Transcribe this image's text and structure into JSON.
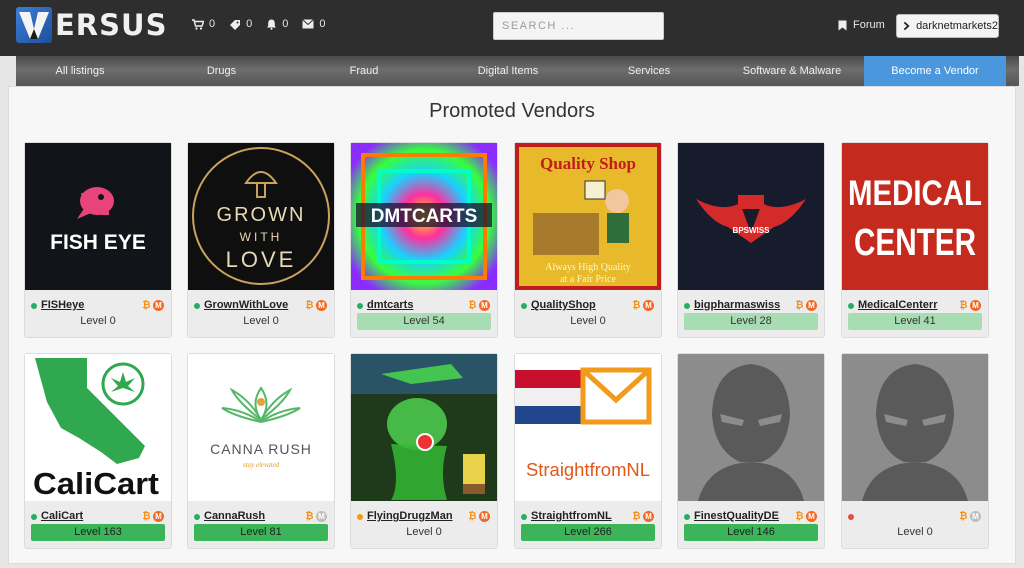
{
  "header": {
    "brand": "ERSUS",
    "logo_letter": "V",
    "counters": [
      {
        "icon": "cart-icon",
        "value": "0"
      },
      {
        "icon": "tag-icon",
        "value": "0"
      },
      {
        "icon": "bell-icon",
        "value": "0"
      },
      {
        "icon": "envelope-icon",
        "value": "0"
      }
    ],
    "search_placeholder": "SEARCH ...",
    "forum_label": "Forum",
    "username": "darknetmarkets2"
  },
  "nav": {
    "items": [
      "All listings",
      "Drugs",
      "Fraud",
      "Digital Items",
      "Services",
      "Software & Malware"
    ],
    "vendor_button": "Become a Vendor"
  },
  "section_title": "Promoted Vendors",
  "colors": {
    "online": "#27ae60",
    "away": "#f39c12",
    "offline": "#e74c3c",
    "level_green_dark": "#3cb55a",
    "level_green_light": "#a8dcb2",
    "accent_blue": "#4a97dd",
    "monero": "#f26822"
  },
  "vendors": [
    {
      "name": "FISHeye",
      "level": "Level 0",
      "status": "online",
      "xmr": true,
      "level_style": "plain",
      "image_text": [
        "FISH EYE"
      ]
    },
    {
      "name": "GrownWithLove",
      "level": "Level 0",
      "status": "online",
      "xmr": true,
      "level_style": "plain",
      "image_text": [
        "GROWN",
        "WITH",
        "LOVE"
      ]
    },
    {
      "name": "dmtcarts",
      "level": "Level 54",
      "status": "online",
      "xmr": true,
      "level_style": "light",
      "image_text": [
        "DMTCARTS"
      ]
    },
    {
      "name": "QualityShop",
      "level": "Level 0",
      "status": "online",
      "xmr": true,
      "level_style": "plain",
      "image_text": [
        "Quality Shop",
        "Always High Quality",
        "at a Fair Price"
      ]
    },
    {
      "name": "bigpharmaswiss",
      "level": "Level 28",
      "status": "online",
      "xmr": true,
      "level_style": "light",
      "image_text": [
        "BPSWISS"
      ]
    },
    {
      "name": "MedicalCenterr",
      "level": "Level 41",
      "status": "online",
      "xmr": true,
      "level_style": "light",
      "image_text": [
        "MEDICAL",
        "CENTER"
      ]
    },
    {
      "name": "CaliCart",
      "level": "Level 163",
      "status": "online",
      "xmr": true,
      "level_style": "dark",
      "image_text": [
        "CaliCart"
      ]
    },
    {
      "name": "CannaRush",
      "level": "Level 81",
      "status": "online",
      "xmr": false,
      "level_style": "dark",
      "image_text": [
        "CANNA RUSH",
        "stay elevated"
      ]
    },
    {
      "name": "FlyingDrugzMan",
      "level": "Level 0",
      "status": "away",
      "xmr": true,
      "level_style": "plain",
      "image_text": []
    },
    {
      "name": "StraightfromNL",
      "level": "Level 266",
      "status": "online",
      "xmr": true,
      "level_style": "dark",
      "image_text": [
        "StraightfromNL"
      ]
    },
    {
      "name": "FinestQualityDE",
      "level": "Level 146",
      "status": "online",
      "xmr": true,
      "level_style": "dark",
      "image_text": []
    },
    {
      "name": "",
      "level": "Level 0",
      "status": "offline",
      "xmr": false,
      "level_style": "plain",
      "image_text": []
    }
  ]
}
